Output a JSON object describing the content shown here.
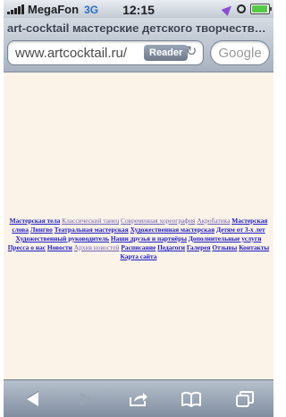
{
  "status": {
    "carrier": "MegaFon",
    "network": "3G",
    "time": "12:15"
  },
  "browser": {
    "page_title": "art-cocktail мастерские детского творчества...",
    "url": "www.artcocktail.ru/",
    "reader_label": "Reader",
    "search_placeholder": "Google"
  },
  "nav": [
    {
      "label": "Мастерская тела",
      "bold": true,
      "visited": false
    },
    {
      "label": "Классический танец",
      "bold": false,
      "visited": true
    },
    {
      "label": "Современная хореография",
      "bold": false,
      "visited": true
    },
    {
      "label": "Акробатика",
      "bold": false,
      "visited": true
    },
    {
      "label": "Мастерская слова",
      "bold": true,
      "visited": false
    },
    {
      "label": "Лингво",
      "bold": true,
      "visited": false
    },
    {
      "label": "Театральная мастерская",
      "bold": true,
      "visited": false
    },
    {
      "label": "Художественная мастерская",
      "bold": true,
      "visited": false
    },
    {
      "label": "Детям от 3-х лет",
      "bold": true,
      "visited": false
    },
    {
      "label": "Художественный руководитель",
      "bold": true,
      "visited": false
    },
    {
      "label": "Наши друзья и партнёры",
      "bold": true,
      "visited": false
    },
    {
      "label": "Дополнительные услуги",
      "bold": true,
      "visited": false
    },
    {
      "label": "Пресса о нас",
      "bold": true,
      "visited": false
    },
    {
      "label": "Новости",
      "bold": true,
      "visited": false
    },
    {
      "label": "Архив новостей",
      "bold": false,
      "visited": true
    },
    {
      "label": "Расписание",
      "bold": true,
      "visited": false
    },
    {
      "label": "Педагоги",
      "bold": true,
      "visited": false
    },
    {
      "label": "Галерея",
      "bold": true,
      "visited": false
    },
    {
      "label": "Отзывы",
      "bold": true,
      "visited": false
    },
    {
      "label": "Контакты",
      "bold": true,
      "visited": false
    },
    {
      "label": "Карта сайта",
      "bold": true,
      "visited": false
    }
  ],
  "toolbar": {
    "icons": [
      "back-icon",
      "forward-icon",
      "share-icon",
      "bookmarks-icon",
      "tabs-icon"
    ]
  }
}
